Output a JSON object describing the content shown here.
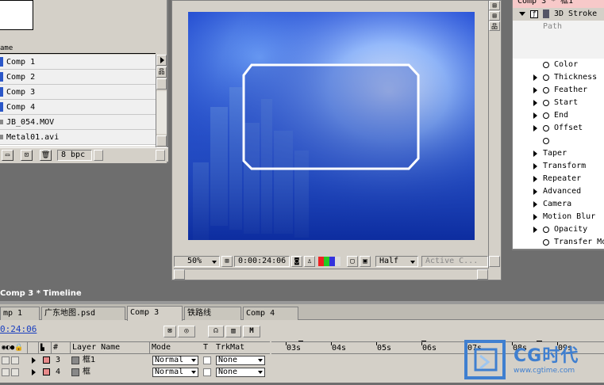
{
  "project": {
    "header": "ame",
    "items": [
      {
        "name": "Comp 1",
        "type": "comp"
      },
      {
        "name": "Comp 2",
        "type": "comp"
      },
      {
        "name": "Comp 3",
        "type": "comp"
      },
      {
        "name": "Comp 4",
        "type": "comp"
      },
      {
        "name": "JB_054.MOV",
        "type": "footage"
      },
      {
        "name": "Metal01.avi",
        "type": "footage"
      }
    ],
    "bpc": "8 bpc"
  },
  "viewer": {
    "zoom": "50%",
    "timecode": "0:00:24:06",
    "resolution": "Half",
    "view": "Active C..."
  },
  "effects": {
    "title": "Comp 3 * 框1",
    "effect_name": "3D Stroke",
    "path_label": "Path",
    "properties": [
      {
        "label": "Color",
        "expand": false
      },
      {
        "label": "Thickness",
        "expand": true
      },
      {
        "label": "Feather",
        "expand": true
      },
      {
        "label": "Start",
        "expand": true
      },
      {
        "label": "End",
        "expand": true
      },
      {
        "label": "Offset",
        "expand": true
      },
      {
        "label": "",
        "expand": false
      }
    ],
    "groups": [
      "Taper",
      "Transform",
      "Repeater",
      "Advanced",
      "Camera",
      "Motion Blur"
    ],
    "opacity": "Opacity",
    "transfer": "Transfer Mo"
  },
  "timeline": {
    "title": "Comp 3 * Timeline",
    "tabs": [
      "mp 1",
      "广东地图.psd",
      "Comp 3",
      "铁路线",
      "Comp 4"
    ],
    "time": "0:24:06",
    "columns": {
      "num": "#",
      "layer": "Layer Name",
      "mode": "Mode",
      "t": "T",
      "trk": "TrkMat"
    },
    "layers": [
      {
        "num": "3",
        "name": "框1",
        "mode": "Normal",
        "trk": "None"
      },
      {
        "num": "4",
        "name": "框",
        "mode": "Normal",
        "trk": "None"
      }
    ],
    "ticks": [
      "03s",
      "04s",
      "05s",
      "06s",
      "07s",
      "08s",
      "09s"
    ]
  },
  "watermark": {
    "brand": "CG时代",
    "url": "www.cgtime.com"
  },
  "colors": {
    "canvas": "#1e4dd8",
    "panel": "#d4d0c8",
    "layer_label": "#e88a8a"
  }
}
